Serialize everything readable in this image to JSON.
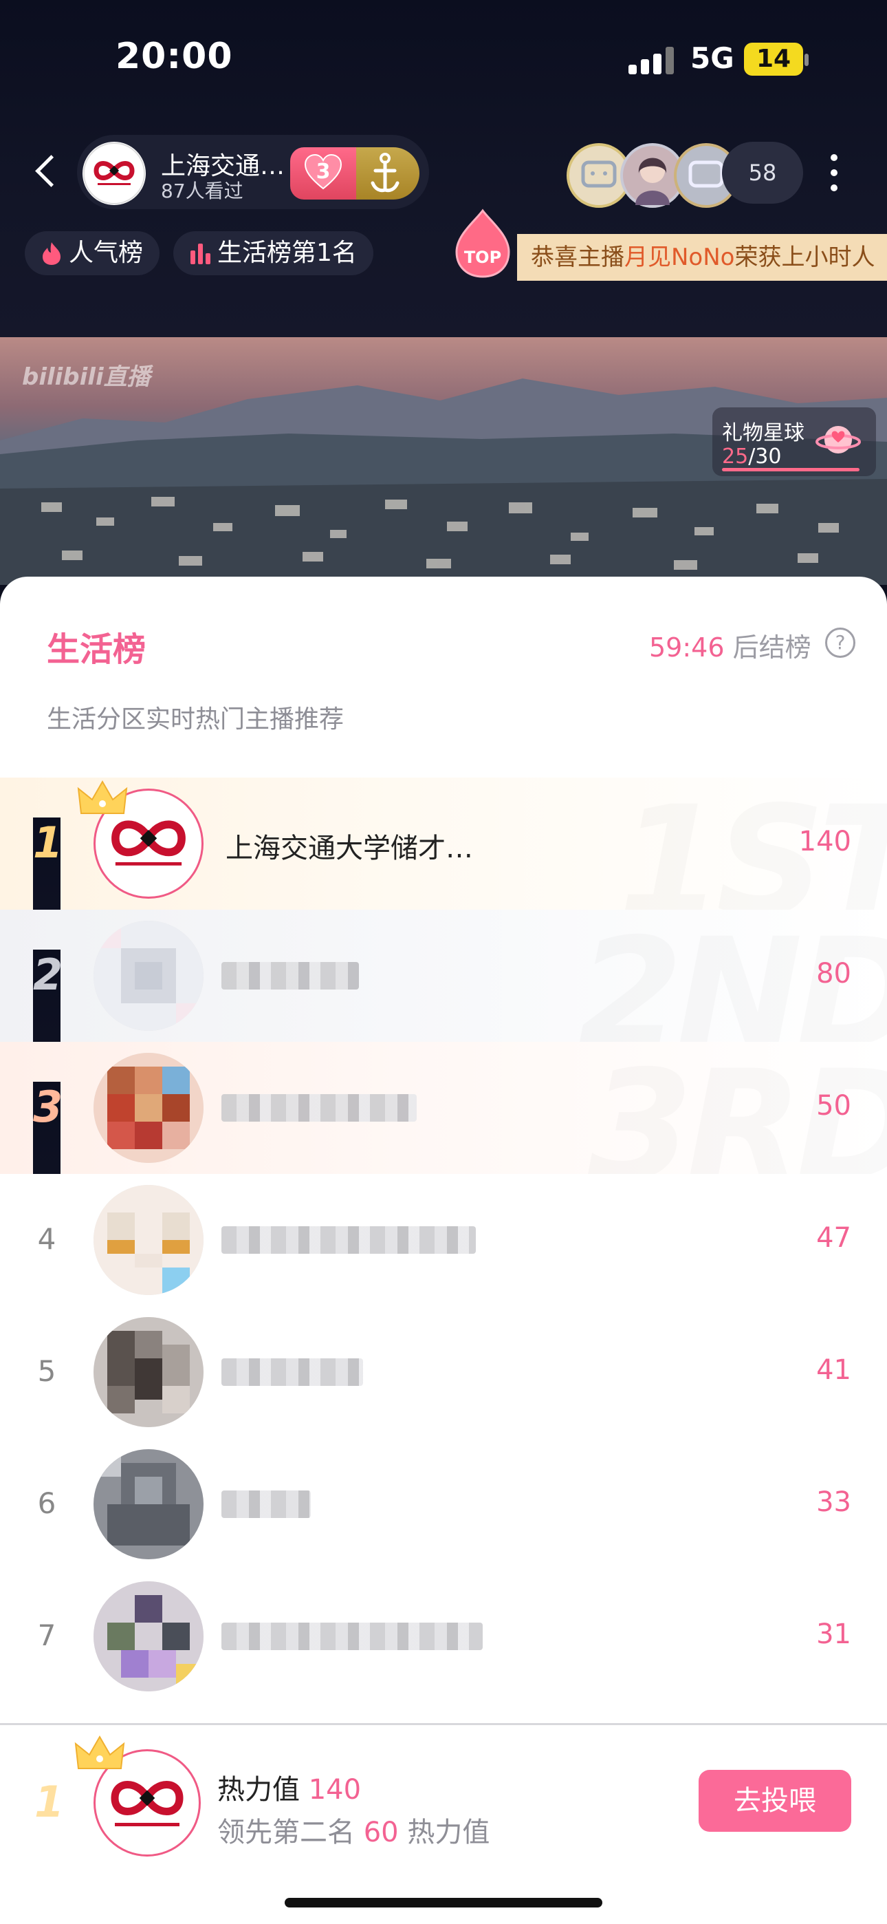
{
  "status_bar": {
    "time": "20:00",
    "network": "5G",
    "battery": "14"
  },
  "header": {
    "anchor_name": "上海交通…",
    "viewers": "87人看过",
    "fan_level": "3",
    "audience_count": "58",
    "tags": [
      {
        "label": "人气榜"
      },
      {
        "label": "生活榜第1名"
      }
    ],
    "top_badge": "TOP",
    "notice": {
      "prefix": "恭喜主播",
      "highlight": "月见NoNo",
      "suffix": "荣获上小时人"
    }
  },
  "video": {
    "watermark": "bilibili直播",
    "gift_planet": {
      "title": "礼物星球",
      "current": "25",
      "total": "/30"
    }
  },
  "panel": {
    "title": "生活榜",
    "countdown": "59:46",
    "countdown_suffix": " 后结榜",
    "help": "?",
    "subtitle": "生活分区实时热门主播推荐"
  },
  "ranking": [
    {
      "rank": "1",
      "name": "上海交通大学储才…",
      "score": "140"
    },
    {
      "rank": "2",
      "name": "",
      "score": "80"
    },
    {
      "rank": "3",
      "name": "",
      "score": "50"
    },
    {
      "rank": "4",
      "name": "",
      "score": "47"
    },
    {
      "rank": "5",
      "name": "",
      "score": "41"
    },
    {
      "rank": "6",
      "name": "",
      "score": "33"
    },
    {
      "rank": "7",
      "name": "",
      "score": "31"
    }
  ],
  "bottom": {
    "rank": "1",
    "heat_label": "热力值 ",
    "heat_value": "140",
    "lead_label": "领先第二名 ",
    "lead_value": "60",
    "lead_suffix": " 热力值",
    "vote_button": "去投喂"
  },
  "colors": {
    "accent": "#f36292",
    "button": "#fb6a98",
    "dark_bg": "#0c0f1e"
  }
}
